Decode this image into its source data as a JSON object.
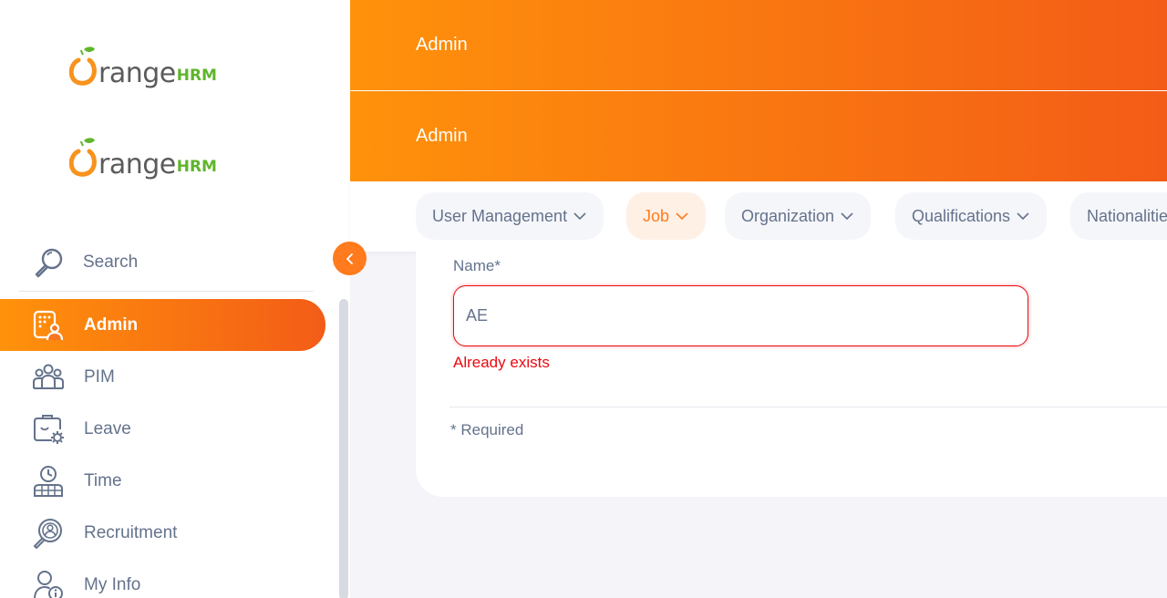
{
  "brand": {
    "logo_main": "range",
    "logo_suffix": "HRM"
  },
  "header": {
    "title_1": "Admin",
    "title_2": "Admin"
  },
  "sidebar": {
    "search_label": "Search",
    "items": [
      {
        "label": "Admin",
        "icon": "admin-icon",
        "active": true
      },
      {
        "label": "PIM",
        "icon": "pim-icon"
      },
      {
        "label": "Leave",
        "icon": "leave-icon"
      },
      {
        "label": "Time",
        "icon": "time-icon"
      },
      {
        "label": "Recruitment",
        "icon": "recruitment-icon"
      },
      {
        "label": "My Info",
        "icon": "my-info-icon"
      }
    ]
  },
  "tabs": [
    {
      "label": "User Management"
    },
    {
      "label": "Job",
      "active": true
    },
    {
      "label": "Organization"
    },
    {
      "label": "Qualifications"
    },
    {
      "label": "Nationalities"
    }
  ],
  "form": {
    "name_label": "Name*",
    "name_value": "AE",
    "name_error": "Already exists",
    "required_note": "* Required"
  },
  "colors": {
    "accent": "#ff7b1d",
    "gradient_start": "#ff920b",
    "gradient_end": "#f35c17",
    "error": "#eb0910"
  }
}
